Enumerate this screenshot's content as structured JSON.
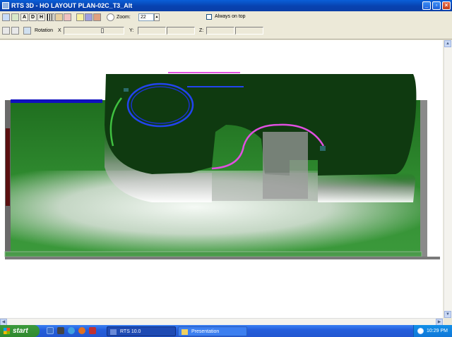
{
  "window": {
    "title": "RTS 3D - HO LAYOUT PLAN-02C_T3_Alt"
  },
  "toolbar": {
    "row1_buttons": [
      "A",
      "D",
      "H"
    ],
    "zoom_label": "Zoom:",
    "zoom_value": "22",
    "always_on_top_label": "Always on top",
    "always_on_top_checked": false,
    "rotation_label": "Rotation",
    "x_label": "X",
    "y_label": "Y:",
    "z_label": "Z:"
  },
  "icons": [
    "app-icon",
    "minimize-icon",
    "restore-icon",
    "close-icon",
    "zoom-magnifier-icon",
    "print-icon",
    "windows-flag-icon",
    "clock-tray-icon"
  ],
  "colors": {
    "titlebar": "#0842b0",
    "layout_green": "#2e8a2e",
    "baseboard_dark": "#0f3a10",
    "track_blue": "#2244ee",
    "track_magenta": "#e050e0",
    "track_green": "#40c040",
    "taskbar": "#245edb",
    "start_green": "#2f8a2f"
  },
  "taskbar": {
    "start_label": "start",
    "tasks": [
      {
        "label": "RTS 10.0"
      },
      {
        "label": "Presentation"
      }
    ],
    "clock": "10:29 PM"
  }
}
